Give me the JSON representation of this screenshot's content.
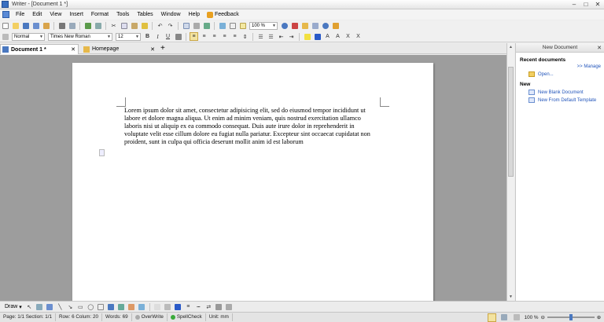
{
  "window": {
    "title": "Writer - [Document 1 *]"
  },
  "menu": {
    "items": [
      "File",
      "Edit",
      "View",
      "Insert",
      "Format",
      "Tools",
      "Tables",
      "Window",
      "Help"
    ],
    "feedback": "Feedback"
  },
  "toolbar1": {
    "zoom": "100 %"
  },
  "toolbar2": {
    "style": "Normal",
    "font": "Times New Roman",
    "size": "12",
    "bold": "B",
    "italic": "I",
    "underline": "U"
  },
  "tabs": [
    {
      "label": "Document 1 *",
      "active": true
    },
    {
      "label": "Homepage",
      "active": false
    }
  ],
  "document": {
    "text": "Lorem ipsum  dolor sit amet, consectetur adipisicing elit, sed do eiusmod tempor incididunt ut labore et dolore magna aliqua. Ut enim ad minim veniam, quis nostrud exercitation ullamco laboris nisi ut aliquip ex ea commodo consequat. Duis aute irure dolor in reprehenderit in voluptate velit esse cillum dolore eu fugiat nulla pariatur. Excepteur sint occaecat cupidatat non proident, sunt in culpa qui officia deserunt mollit anim id est laborum"
  },
  "side_panel": {
    "title": "New Document",
    "recent_heading": "Recent documents",
    "manage": ">> Manage",
    "open": "Open...",
    "new_heading": "New",
    "new_blank": "New Blank Document",
    "new_default": "New From Default Template"
  },
  "drawbar": {
    "draw": "Draw"
  },
  "status": {
    "page": "Page: 1/1 Section: 1/1",
    "position": "Row: 6 Colum: 20",
    "words": "Words: 69",
    "overwrite": "OverWrite",
    "spellcheck": "SpellCheck",
    "unit": "Unit: mm",
    "zoom": "100 %"
  },
  "colors": {
    "accent": "#3a6fc0",
    "page_bg": "#9d9d9d",
    "link": "#2255bb"
  },
  "icons": [
    "document-icon",
    "close-icon",
    "home-icon",
    "plus-icon",
    "folder-icon",
    "new-doc-icon",
    "template-icon"
  ]
}
